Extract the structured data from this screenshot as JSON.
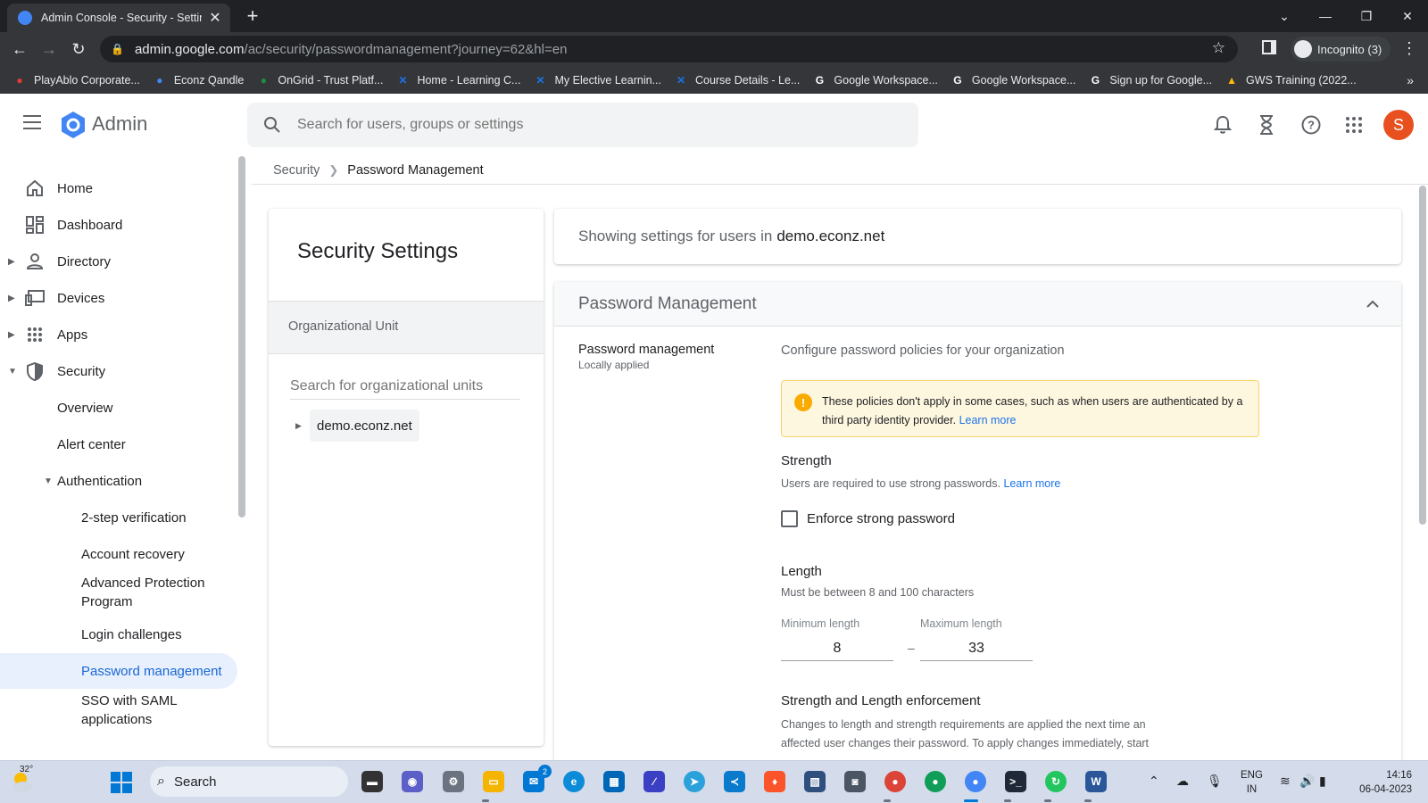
{
  "browser": {
    "tab_title": "Admin Console - Security - Settin",
    "tab_close": "✕",
    "new_tab": "+",
    "url_host": "admin.google.com",
    "url_path": "/ac/security/passwordmanagement?journey=62&hl=en",
    "incognito_label": "Incognito (3)",
    "bookmarks": [
      {
        "label": "PlayAblo Corporate...",
        "icon": "playablo-icon",
        "color": "#e53935"
      },
      {
        "label": "Econz Qandle",
        "icon": "qandle-icon",
        "color": "#4285f4"
      },
      {
        "label": "OnGrid - Trust Platf...",
        "icon": "ongrid-icon",
        "color": "#1e8e3e"
      },
      {
        "label": "Home - Learning C...",
        "icon": "learning-icon",
        "color": "#1a73e8"
      },
      {
        "label": "My Elective Learnin...",
        "icon": "learning-icon",
        "color": "#1a73e8"
      },
      {
        "label": "Course Details - Le...",
        "icon": "learning-icon",
        "color": "#1a73e8"
      },
      {
        "label": "Google Workspace...",
        "icon": "google-icon",
        "color": "#ffffff"
      },
      {
        "label": "Google Workspace...",
        "icon": "google-icon",
        "color": "#ffffff"
      },
      {
        "label": "Sign up for Google...",
        "icon": "google-icon",
        "color": "#ffffff"
      },
      {
        "label": "GWS Training (2022...",
        "icon": "drive-icon",
        "color": "#fbbc04"
      }
    ],
    "bookmarks_more": "»"
  },
  "header": {
    "app_name": "Admin",
    "search_placeholder": "Search for users, groups or settings",
    "avatar_initial": "S"
  },
  "sidebar": {
    "items": [
      {
        "label": "Home"
      },
      {
        "label": "Dashboard"
      },
      {
        "label": "Directory"
      },
      {
        "label": "Devices"
      },
      {
        "label": "Apps"
      },
      {
        "label": "Security"
      },
      {
        "label": "Overview"
      },
      {
        "label": "Alert center"
      },
      {
        "label": "Authentication"
      },
      {
        "label": "2-step verification"
      },
      {
        "label": "Account recovery"
      },
      {
        "label": "Advanced Protection Program"
      },
      {
        "label": "Login challenges"
      },
      {
        "label": "Password management"
      },
      {
        "label": "SSO with SAML applications"
      }
    ]
  },
  "breadcrumb": {
    "parent": "Security",
    "current": "Password Management"
  },
  "ou_panel": {
    "title": "Security Settings",
    "band_label": "Organizational Unit",
    "search_placeholder": "Search for organizational units",
    "root_node": "demo.econz.net"
  },
  "scope": {
    "prefix": "Showing settings for users in",
    "domain": "demo.econz.net"
  },
  "password_card": {
    "title": "Password Management",
    "setting_name": "Password management",
    "setting_status": "Locally applied",
    "description": "Configure password policies for your organization",
    "notice_text": "These policies don't apply in some cases, such as when users are authenticated by a third party identity provider.",
    "notice_link": "Learn more",
    "strength_title": "Strength",
    "strength_sub": "Users are required to use strong passwords.",
    "strength_link": "Learn more",
    "enforce_label": "Enforce strong password",
    "enforce_checked": false,
    "length_title": "Length",
    "length_sub": "Must be between 8 and 100 characters",
    "min_label": "Minimum length",
    "min_value": "8",
    "max_label": "Maximum length",
    "max_value": "33",
    "range_dash": "–",
    "enforcement_title": "Strength and Length enforcement",
    "enforcement_text": "Changes to length and strength requirements are applied the next time an affected user changes their password. To apply changes immediately, start"
  },
  "taskbar": {
    "weather_temp": "32°",
    "search_label": "Search",
    "mail_badge": "2",
    "lang_top": "ENG",
    "lang_bottom": "IN",
    "time": "14:16",
    "date": "06-04-2023"
  },
  "colors": {
    "accent": "#1a73e8",
    "active_nav_bg": "#e8f0fe",
    "notice_bg": "#fef7e0",
    "avatar": "#e8501f"
  }
}
